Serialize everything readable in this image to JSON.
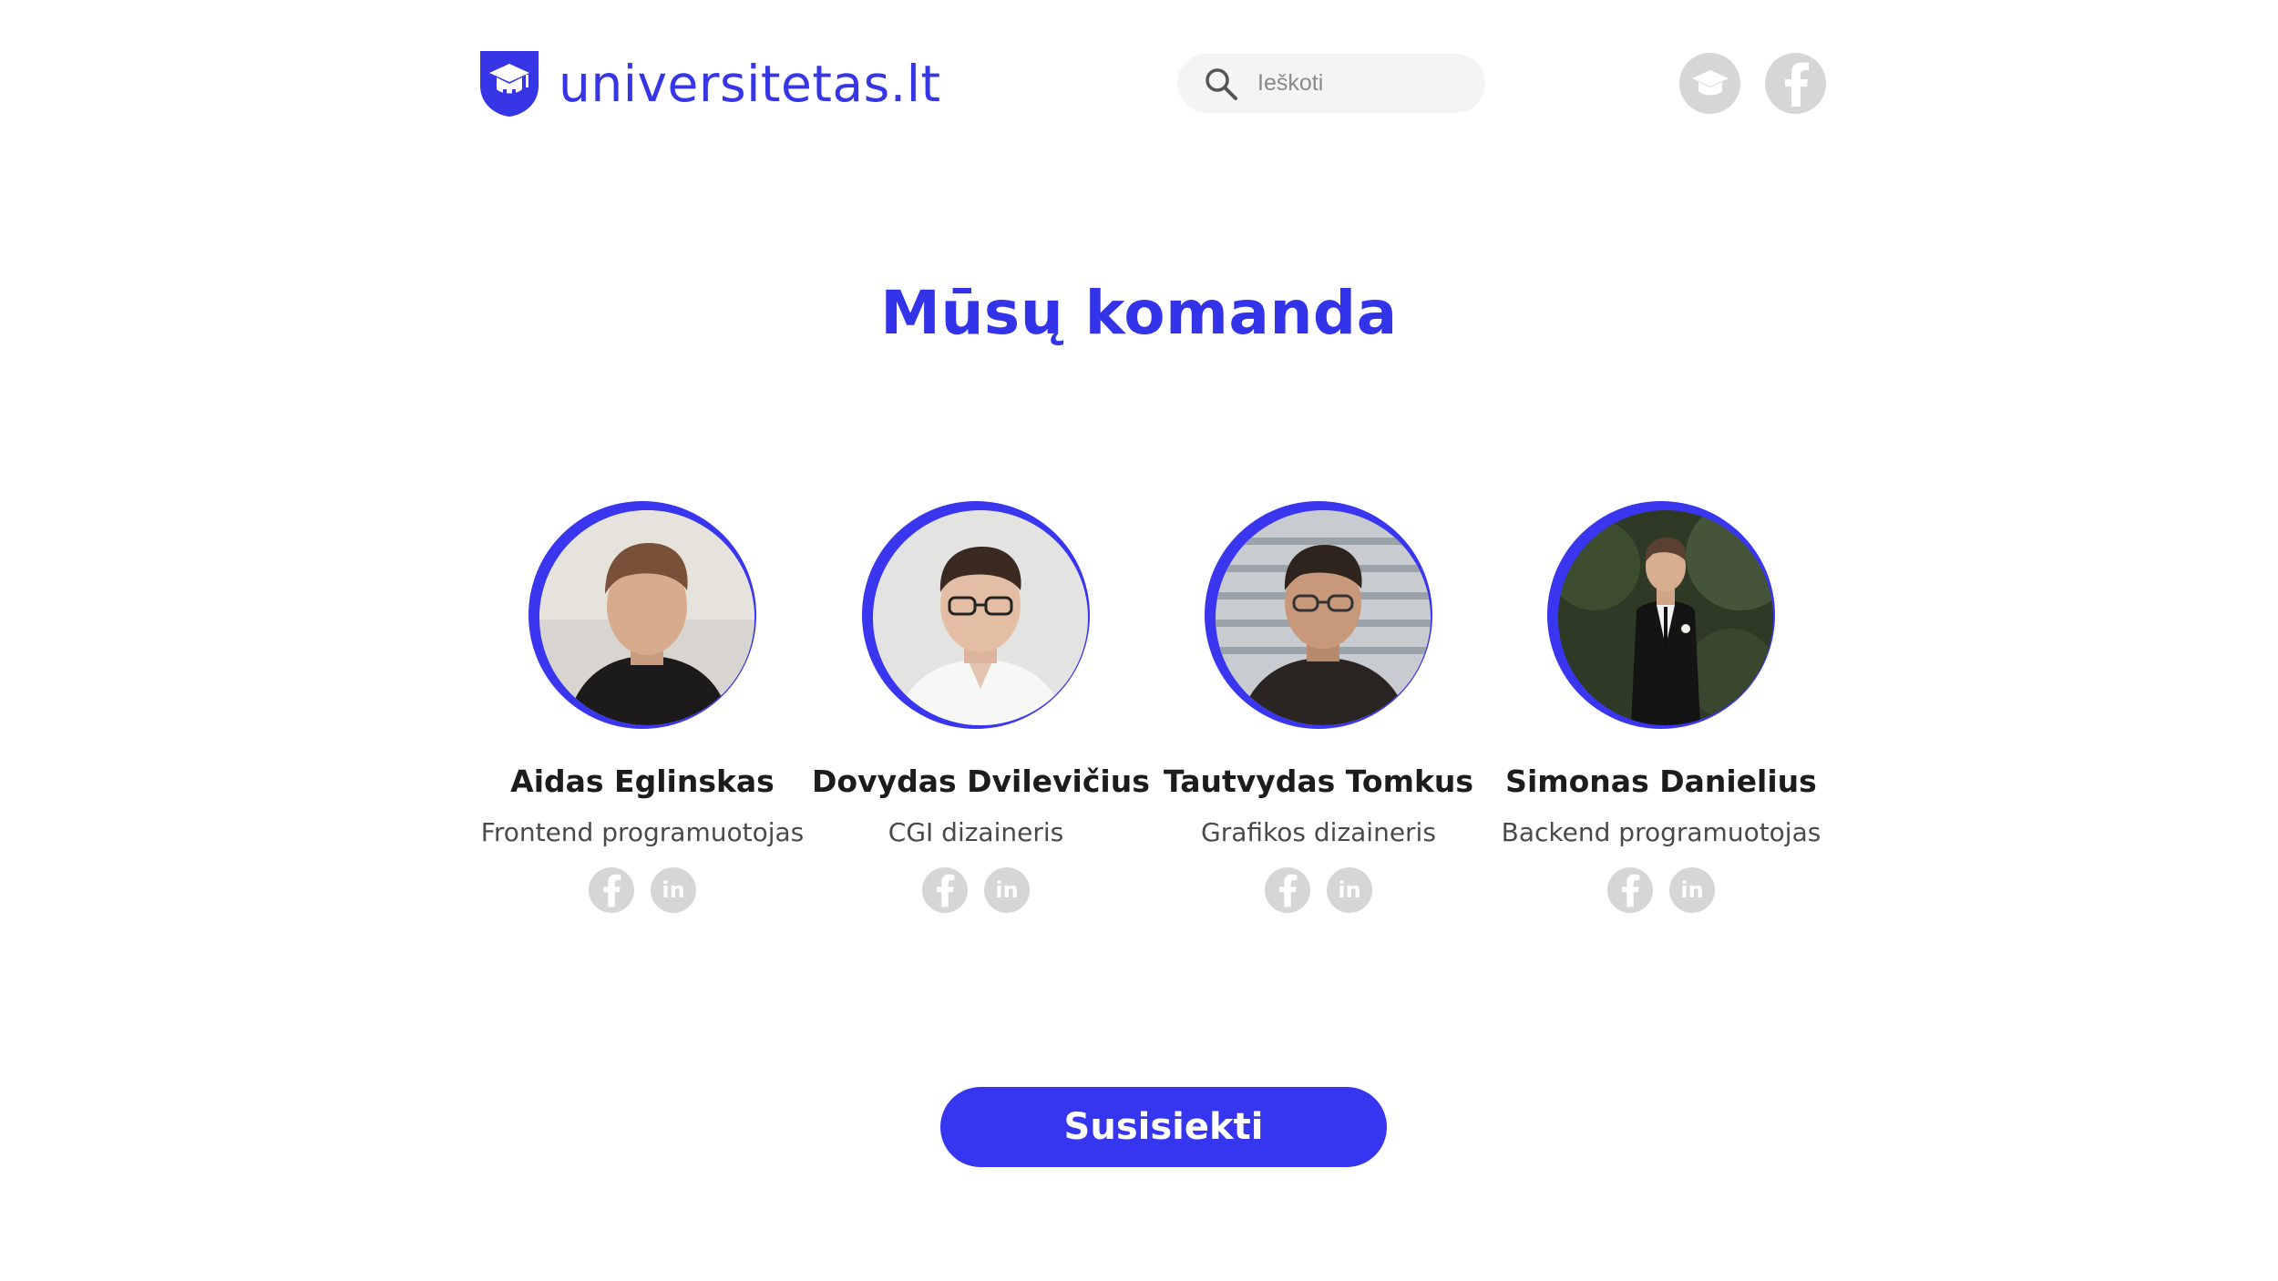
{
  "brand": {
    "name": "universitetas.lt",
    "accent_color": "#3636f0",
    "logo_icon": "graduation-cap-shield-icon"
  },
  "search": {
    "placeholder": "Ieškoti",
    "icon": "search-icon"
  },
  "header_social": [
    {
      "name": "graduation-cap-icon"
    },
    {
      "name": "facebook-icon"
    }
  ],
  "section": {
    "title": "Mūsų komanda"
  },
  "team": [
    {
      "name": "Aidas Eglinskas",
      "role": "Frontend programuotojas",
      "social": [
        "facebook-icon",
        "linkedin-icon"
      ]
    },
    {
      "name": "Dovydas Dvilevičius",
      "role": "CGI dizaineris",
      "social": [
        "facebook-icon",
        "linkedin-icon"
      ]
    },
    {
      "name": "Tautvydas Tomkus",
      "role": "Grafikos dizaineris",
      "social": [
        "facebook-icon",
        "linkedin-icon"
      ]
    },
    {
      "name": "Simonas Danielius",
      "role": "Backend programuotojas",
      "social": [
        "facebook-icon",
        "linkedin-icon"
      ]
    }
  ],
  "cta": {
    "label": "Susisiekti"
  },
  "icons": {
    "linkedin_text": "in"
  }
}
